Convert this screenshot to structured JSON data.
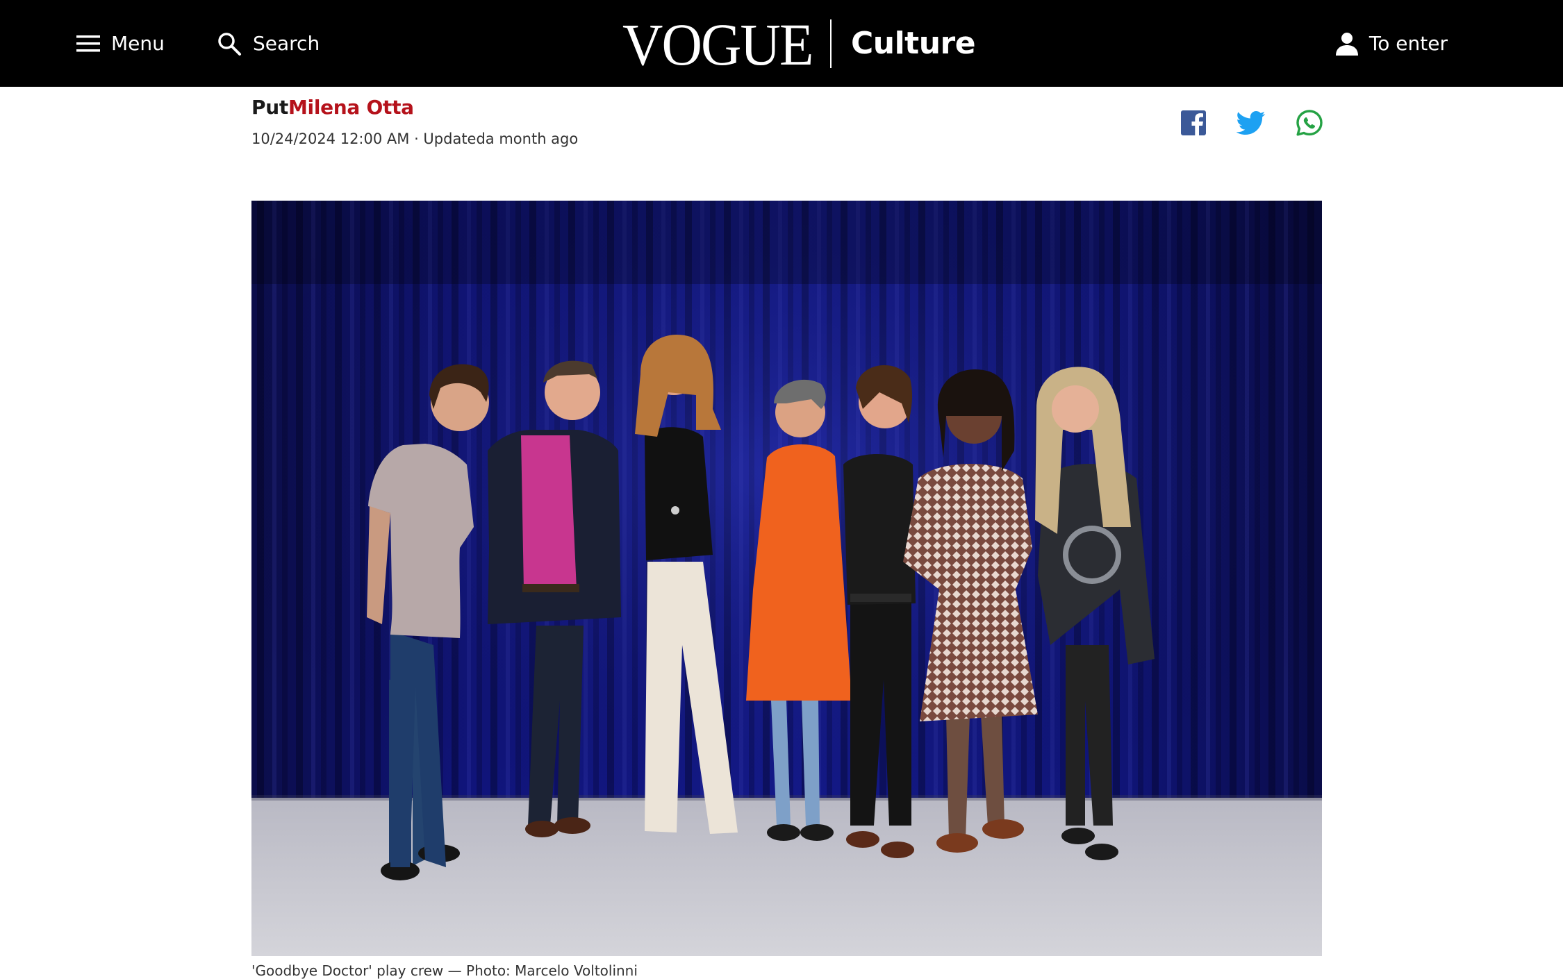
{
  "header": {
    "menu_label": "Menu",
    "search_label": "Search",
    "brand_logo": "VOGUE",
    "brand_section": "Culture",
    "login_label": "To enter",
    "icons": [
      "hamburger-menu-icon",
      "search-icon",
      "user-icon"
    ]
  },
  "article": {
    "byline_prefix": "Put",
    "author": "Milena Otta",
    "dateline": "10/24/2024 12:00 AM · Updateda month ago",
    "share": {
      "icons": [
        "facebook-icon",
        "twitter-icon",
        "whatsapp-icon"
      ],
      "colors": {
        "facebook": "#3b5998",
        "twitter": "#1da1f2",
        "whatsapp": "#25a244"
      }
    },
    "image": {
      "subject": "group-photo-seven-people-on-stage",
      "caption": "'Goodbye Doctor' play crew — Photo: Marcelo Voltolinni"
    }
  },
  "colors": {
    "header_bg": "#000000",
    "author_accent": "#b5121b",
    "curtain": "#0d1160"
  }
}
